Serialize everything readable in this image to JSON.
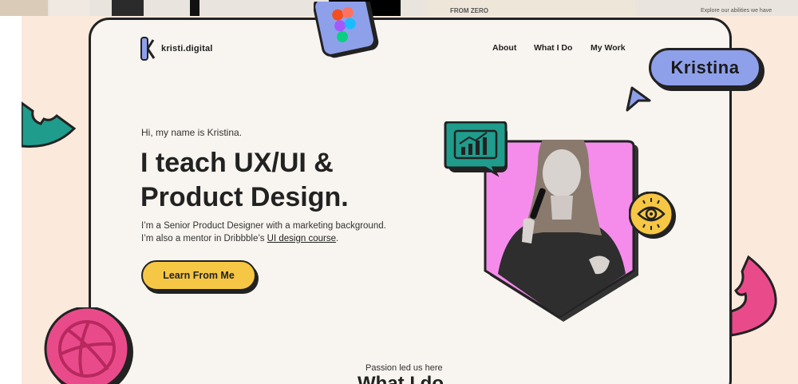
{
  "top_strip": {
    "label_left": "FROM ZERO",
    "label_right": "Explore our abilities we have"
  },
  "logo": {
    "text": "kristi.digital"
  },
  "nav": {
    "about": "About",
    "what_i_do": "What I Do",
    "my_work": "My Work"
  },
  "name_badge": "Kristina",
  "hero": {
    "greeting": "Hi, my name is Kristina.",
    "headline_line1": "I teach UX/UI &",
    "headline_line2": "Product Design.",
    "desc_line1": "I’m a Senior Product Designer with a marketing background.",
    "desc_line2_prefix": "I’m also a mentor in Dribbble’s ",
    "desc_link": "UI design course",
    "desc_line2_suffix": ".",
    "cta_label": "Learn From Me"
  },
  "section": {
    "eyebrow": "Passion led us here",
    "title": "What I do"
  },
  "colors": {
    "card_bg": "#f8f4ef",
    "peach_bg": "#fbe9dc",
    "accent_yellow": "#f6c744",
    "accent_blue": "#8fa0ea",
    "accent_pink": "#f58cec",
    "accent_teal": "#1f9c8c",
    "accent_magenta": "#e94b8a",
    "outline": "#222222"
  },
  "icons": [
    "figma-logo-icon",
    "chart-screen-icon",
    "eye-icon",
    "cursor-arrow-icon",
    "dribbble-icon",
    "teal-shape-decor",
    "pink-shape-decor"
  ]
}
